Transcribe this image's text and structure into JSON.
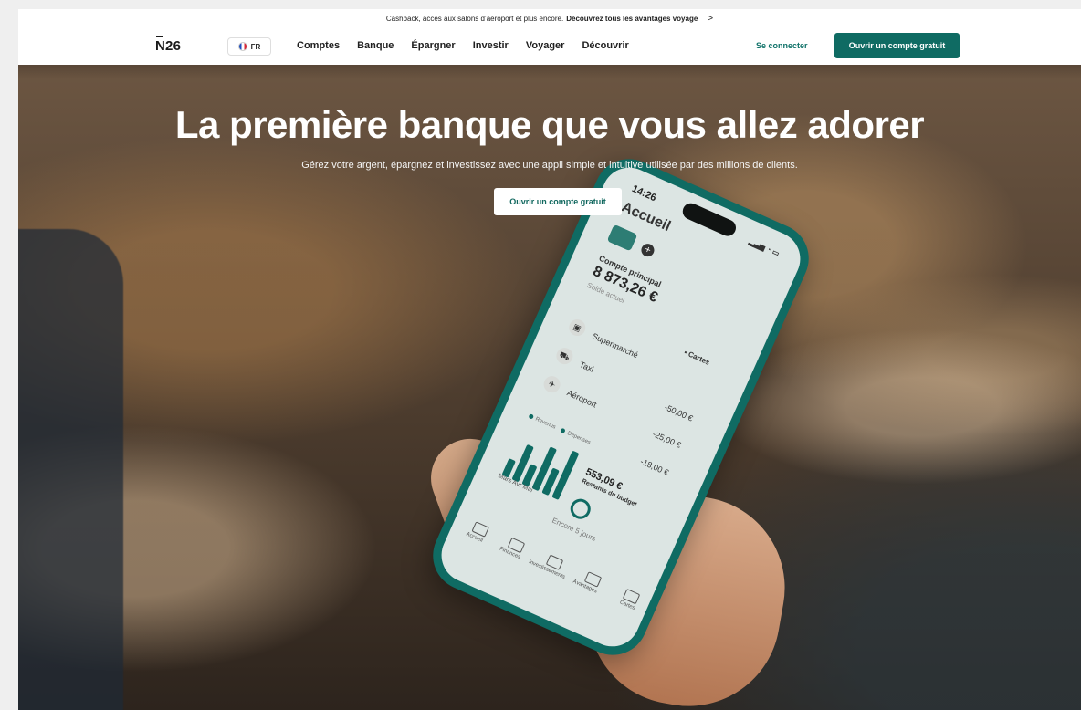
{
  "announcement": {
    "text": "Cashback, accès aux salons d’aéroport et plus encore.",
    "link": "Découvrez tous les avantages voyage",
    "chevron": ">"
  },
  "header": {
    "logo": "N26",
    "language": "FR",
    "menu": [
      "Comptes",
      "Banque",
      "Épargner",
      "Investir",
      "Voyager",
      "Découvrir"
    ],
    "login": "Se connecter",
    "cta": "Ouvrir un compte gratuit"
  },
  "hero": {
    "title": "La première banque que vous allez adorer",
    "subtitle": "Gérez votre argent, épargnez et investissez avec une appli simple et intuitive utilisée par des millions de clients.",
    "cta": "Ouvrir un compte gratuit"
  },
  "phone": {
    "time": "14:26",
    "screen_title": "Accueil",
    "account_label": "Compte principal",
    "balance": "8 873,26 €",
    "balance_sub": "Solde actuel",
    "cards_tag": "Cartes",
    "transactions": [
      {
        "name": "Supermarché",
        "amount": "-50,00 €"
      },
      {
        "name": "Taxi",
        "amount": "-25,00 €"
      },
      {
        "name": "Aéroport",
        "amount": "-18,00 €"
      }
    ],
    "legend": [
      "Revenus",
      "Dépenses"
    ],
    "chart_labels": [
      "Mars",
      "Avr",
      "Mai"
    ],
    "budget": "553,09 €",
    "budget_label": "Restants du budget",
    "days_left": "Encore 5 jours",
    "bottom_nav": [
      "Accueil",
      "Finances",
      "Investissements",
      "Avantages",
      "Cartes"
    ]
  }
}
